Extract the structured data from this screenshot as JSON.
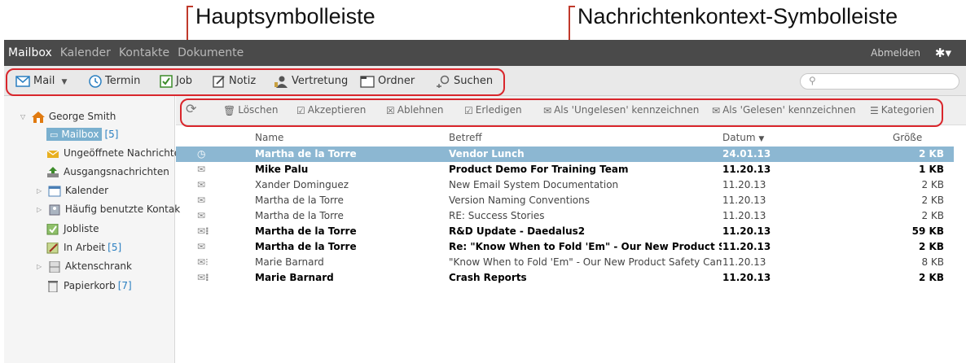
{
  "annotations": {
    "main_toolbar": "Hauptsymbolleiste",
    "context_toolbar": "Nachrichtenkontext-Symbolleiste"
  },
  "topnav": {
    "tabs": [
      "Mailbox",
      "Kalender",
      "Kontakte",
      "Dokumente"
    ],
    "logout": "Abmelden",
    "settings_icon": "gear-icon"
  },
  "maintoolbar": {
    "mail": "Mail",
    "termin": "Termin",
    "job": "Job",
    "notiz": "Notiz",
    "vertretung": "Vertretung",
    "ordner": "Ordner",
    "suchen": "Suchen",
    "search_placeholder": ""
  },
  "sidebar": {
    "user": "George Smith",
    "items": [
      {
        "label": "Mailbox",
        "count": "[5]"
      },
      {
        "label": "Ungeöffnete Nachrichte",
        "count": ""
      },
      {
        "label": "Ausgangsnachrichten",
        "count": ""
      },
      {
        "label": "Kalender",
        "count": ""
      },
      {
        "label": "Häufig benutzte Kontak",
        "count": ""
      },
      {
        "label": "Jobliste",
        "count": ""
      },
      {
        "label": "In Arbeit",
        "count": "[5]"
      },
      {
        "label": "Aktenschrank",
        "count": ""
      },
      {
        "label": "Papierkorb",
        "count": "[7]"
      }
    ]
  },
  "contexttoolbar": {
    "loeschen": "Löschen",
    "akzeptieren": "Akzeptieren",
    "ablehnen": "Ablehnen",
    "erledigen": "Erledigen",
    "ungelesen": "Als 'Ungelesen' kennzeichnen",
    "gelesen": "Als 'Gelesen' kennzeichnen",
    "kategorien": "Kategorien"
  },
  "list": {
    "headers": {
      "name": "Name",
      "subject": "Betreff",
      "date": "Datum",
      "size": "Größe"
    },
    "rows": [
      {
        "name": "Martha de la Torre",
        "subject": "Vendor Lunch",
        "date": "24.01.13",
        "size": "2 KB"
      },
      {
        "name": "Mike Palu",
        "subject": "Product Demo For Training Team",
        "date": "11.20.13",
        "size": "1 KB"
      },
      {
        "name": "Xander Dominguez",
        "subject": "New Email System Documentation",
        "date": "11.20.13",
        "size": "2 KB"
      },
      {
        "name": "Martha de la Torre",
        "subject": "Version Naming Conventions",
        "date": "11.20.13",
        "size": "2 KB"
      },
      {
        "name": "Martha de la Torre",
        "subject": "RE: Success Stories",
        "date": "11.20.13",
        "size": "2 KB"
      },
      {
        "name": "Martha de la Torre",
        "subject": "R&D Update - Daedalus2",
        "date": "11.20.13",
        "size": "59 KB"
      },
      {
        "name": "Martha de la Torre",
        "subject": "Re: \"Know When to Fold 'Em\" - Our New Product Safety",
        "date": "11.20.13",
        "size": "2 KB"
      },
      {
        "name": "Marie Barnard",
        "subject": "\"Know When to Fold 'Em\" - Our New Product Safety Campa",
        "date": "11.20.13",
        "size": "8 KB"
      },
      {
        "name": "Marie Barnard",
        "subject": "Crash Reports",
        "date": "11.20.13",
        "size": "2 KB"
      }
    ]
  }
}
